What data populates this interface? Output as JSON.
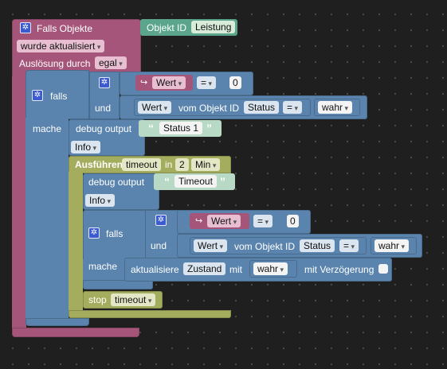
{
  "outer": {
    "title": "Falls Objekte",
    "object_id_label": "Objekt ID",
    "object_id_value": "Leistung",
    "trigger": "wurde aktualisiert",
    "triggered_by_label": "Auslösung durch",
    "triggered_by_value": "egal"
  },
  "if1": {
    "falls": "falls",
    "und": "und",
    "mache": "mache",
    "cond1": {
      "var": "Wert",
      "op": "=",
      "value": "0"
    },
    "cond2": {
      "attr": "Wert",
      "text": "vom Objekt ID",
      "id": "Status",
      "op": "=",
      "value": "wahr"
    }
  },
  "debug1": {
    "label": "debug output",
    "text": "Status 1",
    "level": "Info"
  },
  "timeout": {
    "label": "Ausführen",
    "name": "timeout",
    "in": "in",
    "value": "2",
    "unit": "Min",
    "debug_label": "debug output",
    "debug_text": "Timeout",
    "debug_level": "Info",
    "stop": "stop",
    "stop_name": "timeout"
  },
  "if2": {
    "falls": "falls",
    "und": "und",
    "mache": "mache",
    "cond1": {
      "var": "Wert",
      "op": "=",
      "value": "0"
    },
    "cond2": {
      "attr": "Wert",
      "text": "vom Objekt ID",
      "id": "Status",
      "op": "=",
      "value": "wahr"
    },
    "update_label": "aktualisiere",
    "update_target": "Zustand",
    "update_mit": "mit",
    "update_value": "wahr",
    "update_delay": "mit Verzögerung"
  },
  "icons": {
    "gear": "gear-icon",
    "var": "variable-arrow-icon"
  }
}
